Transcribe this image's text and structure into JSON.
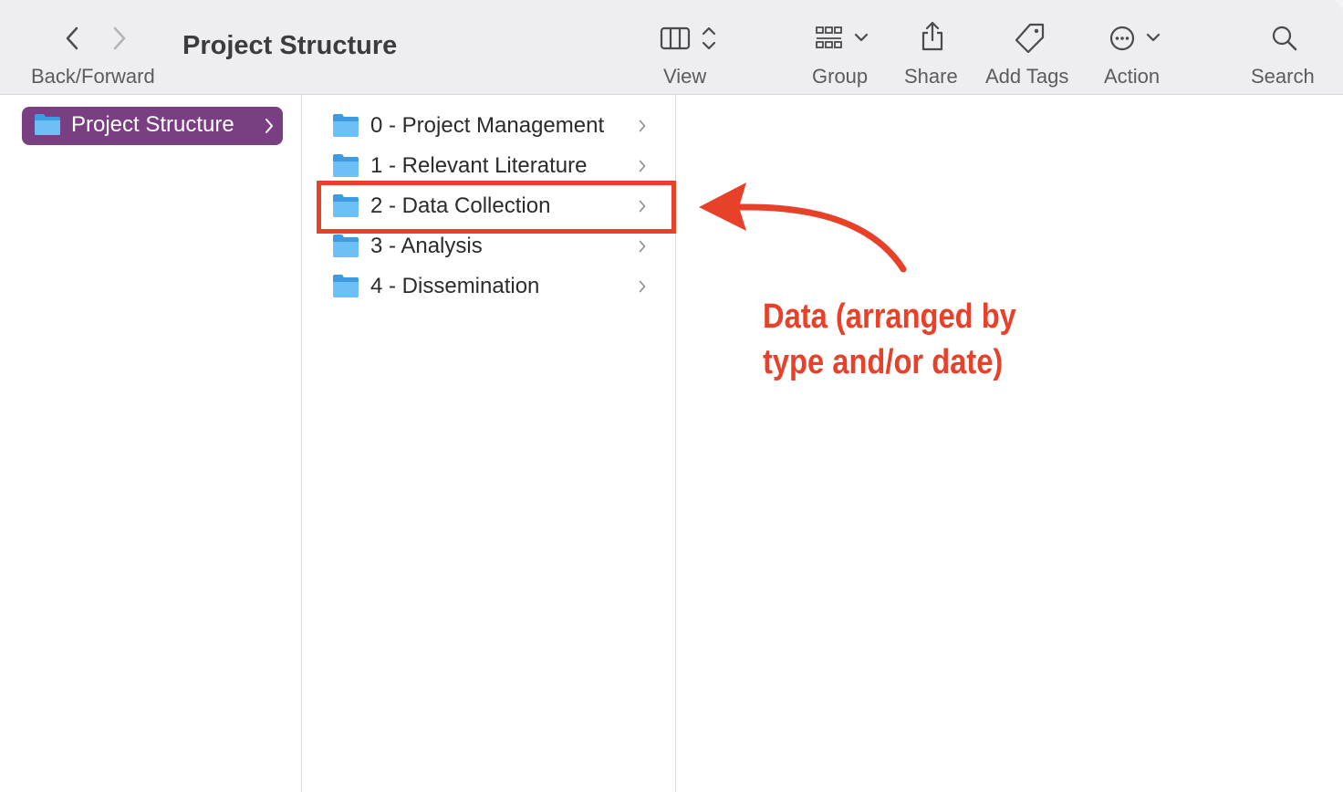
{
  "toolbar": {
    "title": "Project Structure",
    "nav_label": "Back/Forward",
    "view_label": "View",
    "group_label": "Group",
    "share_label": "Share",
    "tags_label": "Add Tags",
    "action_label": "Action",
    "search_label": "Search"
  },
  "sidebar": {
    "selected": {
      "label": "Project Structure",
      "icon": "folder-icon"
    }
  },
  "column2": {
    "items": [
      {
        "label": "0 - Project Management",
        "icon": "folder-icon"
      },
      {
        "label": "1 - Relevant Literature",
        "icon": "folder-icon"
      },
      {
        "label": "2 - Data Collection",
        "icon": "folder-icon"
      },
      {
        "label": "3 - Analysis",
        "icon": "folder-icon"
      },
      {
        "label": "4 - Dissemination",
        "icon": "folder-icon"
      }
    ]
  },
  "annotation": {
    "line1": "Data (arranged by",
    "line2": "type and/or date)",
    "color": "#e8412a"
  },
  "colors": {
    "selection": "#7a3f83",
    "folder": "#5fb3ec",
    "accent_red": "#e8412a"
  }
}
